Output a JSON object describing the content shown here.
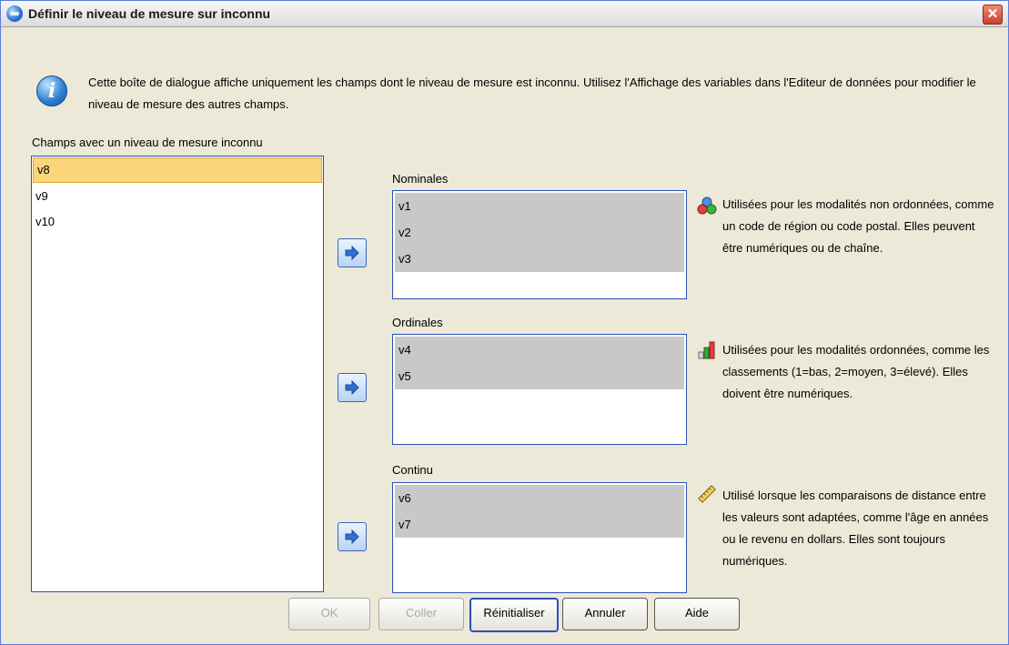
{
  "window": {
    "title": "Définir le niveau de mesure sur inconnu",
    "close_label": "✕"
  },
  "info": {
    "icon": "info-icon",
    "text": "Cette boîte de dialogue affiche uniquement les champs dont le niveau de mesure est inconnu. Utilisez l'Affichage des variables dans l'Editeur de données pour modifier le niveau de mesure des autres champs."
  },
  "unknown_fields": {
    "label": "Champs avec un niveau de mesure inconnu",
    "items": [
      "v8",
      "v9",
      "v10"
    ],
    "selected": "v8"
  },
  "nominal": {
    "label": "Nominales",
    "items": [
      "v1",
      "v2",
      "v3"
    ],
    "icon": "nominal-icon",
    "description": "Utilisées pour les modalités non ordonnées, comme un code de région ou code postal. Elles peuvent être numériques ou de chaîne."
  },
  "ordinal": {
    "label": "Ordinales",
    "items": [
      "v4",
      "v5"
    ],
    "icon": "ordinal-bar-icon",
    "description": "Utilisées pour les modalités ordonnées, comme les classements (1=bas, 2=moyen, 3=élevé). Elles doivent être numériques."
  },
  "continuous": {
    "label": "Continu",
    "items": [
      "v6",
      "v7"
    ],
    "icon": "ruler-icon",
    "description": "Utilisé lorsque les comparaisons de distance entre les valeurs sont adaptées, comme l'âge en années ou le revenu en dollars. Elles sont toujours numériques."
  },
  "buttons": {
    "ok": "OK",
    "paste": "Coller",
    "reset": "Réinitialiser",
    "cancel": "Annuler",
    "help": "Aide"
  },
  "colors": {
    "selected_item": "#fbd57a",
    "list_border": "#2d50b8",
    "dialog_bg": "#ece9d8",
    "moved_item_bg": "#c8c8c8"
  }
}
